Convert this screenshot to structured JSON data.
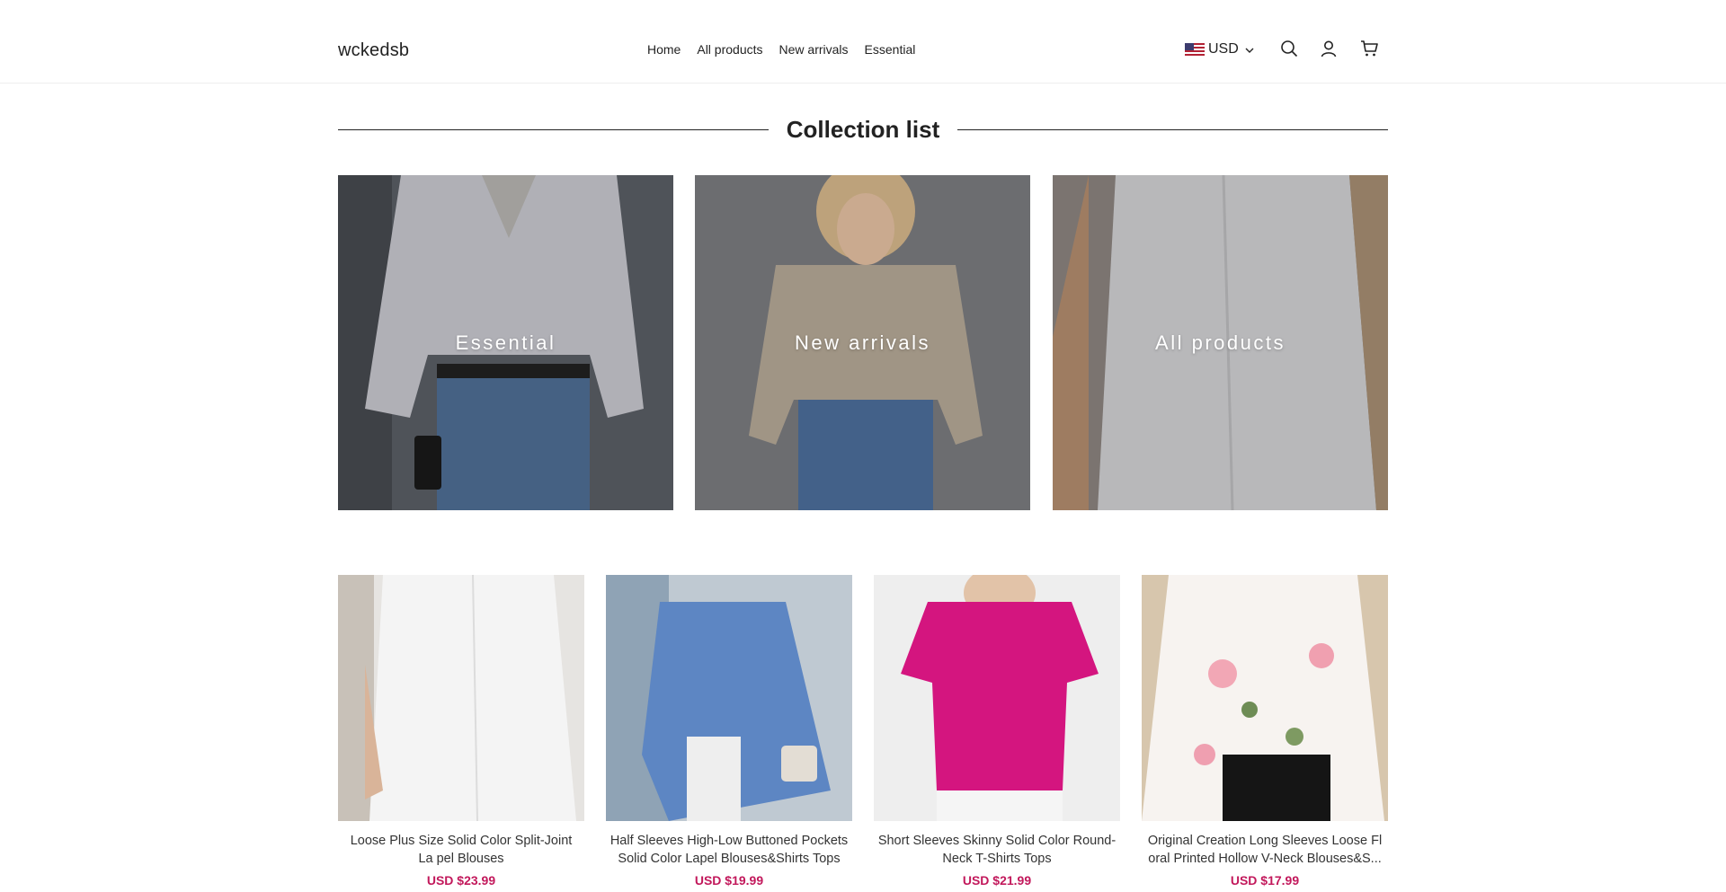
{
  "header": {
    "logo": "wckedsb",
    "nav": [
      "Home",
      "All products",
      "New arrivals",
      "Essential"
    ],
    "currency": "USD",
    "icons": [
      "flag-us-icon",
      "chevron-down-icon",
      "search-icon",
      "account-icon",
      "cart-icon"
    ]
  },
  "collection": {
    "title": "Collection list",
    "items": [
      {
        "label": "Essential"
      },
      {
        "label": "New arrivals"
      },
      {
        "label": "All products"
      }
    ]
  },
  "products": [
    {
      "title": "Loose Plus Size Solid Color Split-Joint La pel Blouses",
      "price": "USD $23.99"
    },
    {
      "title": "Half Sleeves High-Low Buttoned Pockets Solid Color Lapel Blouses&Shirts Tops",
      "price": "USD $19.99"
    },
    {
      "title": "Short Sleeves Skinny Solid Color Round-Neck T-Shirts Tops",
      "price": "USD $21.99"
    },
    {
      "title": "Original Creation Long Sleeves Loose Fl oral Printed Hollow V-Neck Blouses&S...",
      "price": "USD $17.99"
    }
  ],
  "colors": {
    "price": "#c2185b",
    "text": "#222222",
    "divider": "#eeeeee"
  }
}
